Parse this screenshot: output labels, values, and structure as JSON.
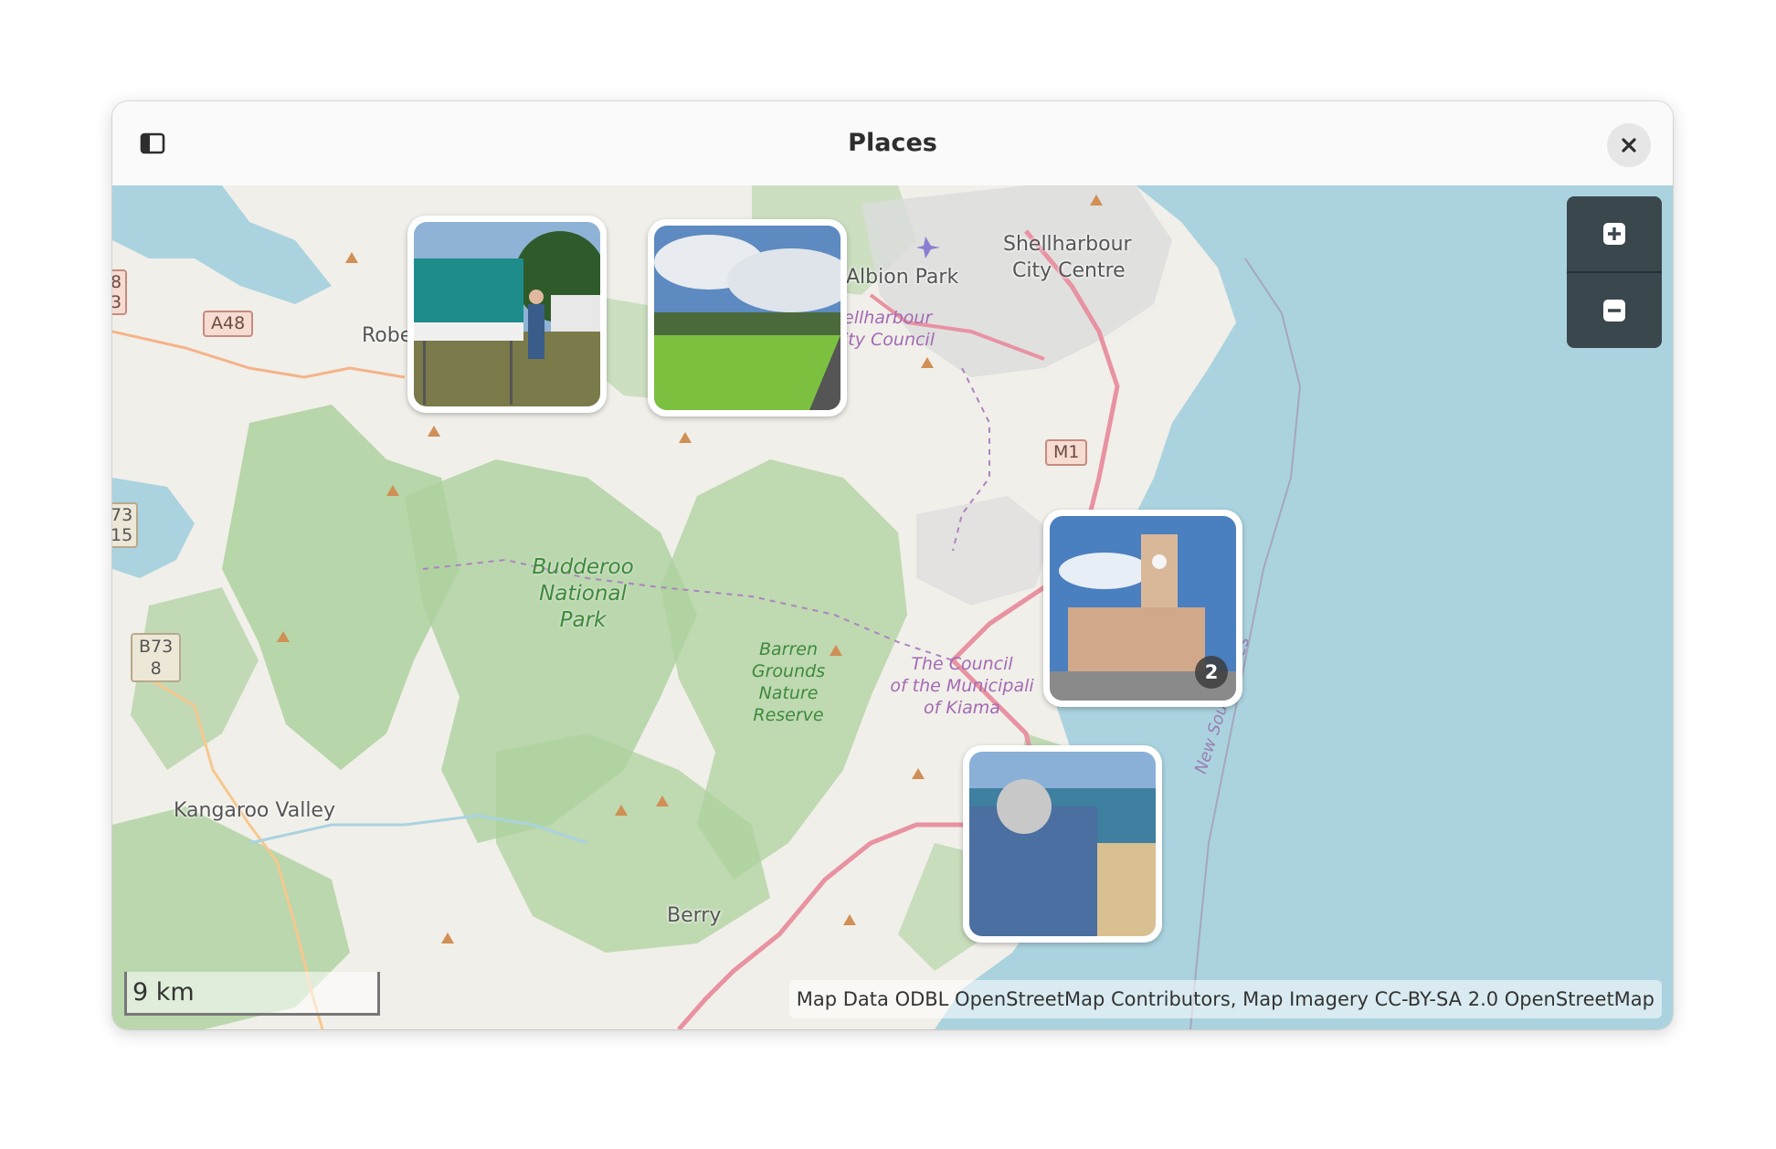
{
  "window": {
    "title": "Places"
  },
  "icons": {
    "sidebar": "sidebar-toggle-icon",
    "close": "close-icon",
    "zoom_in": "plus-icon",
    "zoom_out": "minus-icon"
  },
  "map": {
    "labels": {
      "albion_park": "Albion Park",
      "shellharbour_line1": "Shellharbour",
      "shellharbour_line2": "City Centre",
      "shellharbour_council_line1": "ellharbour",
      "shellharbour_council_line2": "ity Council",
      "robe": "Robe",
      "kangaroo_valley": "Kangaroo Valley",
      "berry": "Berry",
      "budderoo_line1": "Budderoo",
      "budderoo_line2": "National",
      "budderoo_line3": "Park",
      "barren_line1": "Barren",
      "barren_line2": "Grounds",
      "barren_line3": "Nature",
      "barren_line4": "Reserve",
      "kiama_line1": "The Council",
      "kiama_line2": "of the Municipali",
      "kiama_line3": "of Kiama",
      "nsw": "New South Wales"
    },
    "roads": {
      "a48": "A48",
      "m1": "M1",
      "b73": "B73",
      "b73_sub": "8",
      "left_top_1": "8",
      "left_top_2": "3",
      "left_mid_1": "73",
      "left_mid_2": "15"
    },
    "cluster_count": "2",
    "scale": "9 km",
    "attribution": "Map Data ODBL OpenStreetMap Contributors, Map Imagery CC-BY-SA 2.0 OpenStreetMap",
    "colors": {
      "water": "#aad3df",
      "land": "#f1efe9",
      "forest": "#add19e",
      "motorway": "#e892a2",
      "boundary": "#ac84c0"
    }
  }
}
